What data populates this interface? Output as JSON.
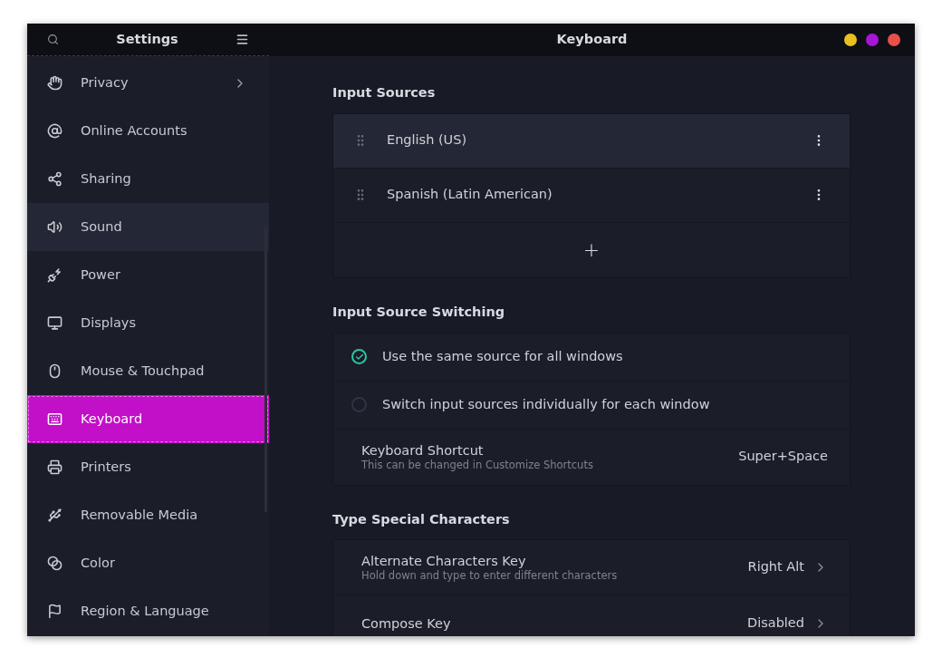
{
  "window": {
    "sidebar_title": "Settings",
    "title": "Keyboard",
    "controls": [
      {
        "color": "#e8c020"
      },
      {
        "color": "#a516d8"
      },
      {
        "color": "#e8504a"
      }
    ]
  },
  "sidebar": {
    "items": [
      {
        "label": "Privacy",
        "kind": "submenu",
        "selected": false,
        "hovered": false
      },
      {
        "label": "Online Accounts",
        "kind": "page",
        "selected": false,
        "hovered": false
      },
      {
        "label": "Sharing",
        "kind": "page",
        "selected": false,
        "hovered": false
      },
      {
        "label": "Sound",
        "kind": "page",
        "selected": false,
        "hovered": true
      },
      {
        "label": "Power",
        "kind": "page",
        "selected": false,
        "hovered": false
      },
      {
        "label": "Displays",
        "kind": "page",
        "selected": false,
        "hovered": false
      },
      {
        "label": "Mouse & Touchpad",
        "kind": "page",
        "selected": false,
        "hovered": false
      },
      {
        "label": "Keyboard",
        "kind": "page",
        "selected": true,
        "hovered": false
      },
      {
        "label": "Printers",
        "kind": "page",
        "selected": false,
        "hovered": false
      },
      {
        "label": "Removable Media",
        "kind": "page",
        "selected": false,
        "hovered": false
      },
      {
        "label": "Color",
        "kind": "page",
        "selected": false,
        "hovered": false
      },
      {
        "label": "Region & Language",
        "kind": "page",
        "selected": false,
        "hovered": false
      }
    ]
  },
  "sections": [
    {
      "title": "Input Sources",
      "rows": [
        {
          "kind": "source",
          "label": "English (US)",
          "hovered": true
        },
        {
          "kind": "source",
          "label": "Spanish (Latin American)",
          "hovered": false
        },
        {
          "kind": "add",
          "label": "+"
        }
      ]
    },
    {
      "title": "Input Source Switching",
      "rows": [
        {
          "kind": "radio",
          "label": "Use the same source for all windows",
          "selected": true
        },
        {
          "kind": "radio",
          "label": "Switch input sources individually for each window",
          "selected": false
        },
        {
          "kind": "setting",
          "label": "Keyboard Shortcut",
          "description": "This can be changed in Customize Shortcuts",
          "value": "Super+Space",
          "chevron": false
        }
      ]
    },
    {
      "title": "Type Special Characters",
      "rows": [
        {
          "kind": "setting",
          "label": "Alternate Characters Key",
          "description": "Hold down and type to enter different characters",
          "value": "Right Alt",
          "chevron": true
        },
        {
          "kind": "setting",
          "label": "Compose Key",
          "value": "Disabled",
          "chevron": true
        }
      ]
    }
  ]
}
